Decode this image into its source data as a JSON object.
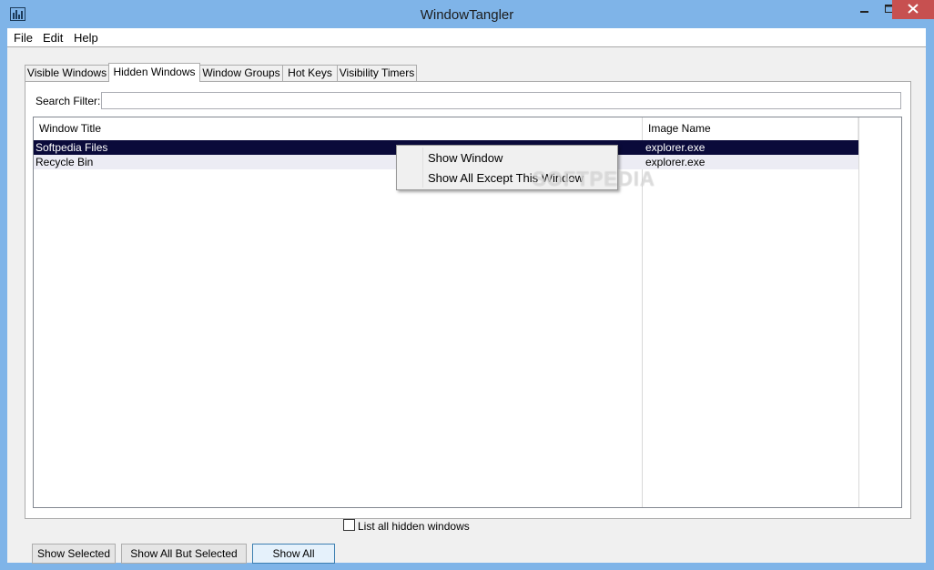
{
  "window": {
    "title": "WindowTangler",
    "colors": {
      "frame": "#7fb4e8",
      "close": "#c75050",
      "selection": "#0a0a3a"
    }
  },
  "icons": {
    "app": "chart-bars-icon",
    "minimize": "minimize-icon",
    "maximize": "maximize-icon",
    "close": "close-icon"
  },
  "menubar": {
    "items": [
      "File",
      "Edit",
      "Help"
    ]
  },
  "tabs": [
    {
      "label": "Visible Windows",
      "active": false
    },
    {
      "label": "Hidden Windows",
      "active": true
    },
    {
      "label": "Window Groups",
      "active": false
    },
    {
      "label": "Hot Keys",
      "active": false
    },
    {
      "label": "Visibility Timers",
      "active": false
    }
  ],
  "search": {
    "label": "Search Filter:",
    "value": ""
  },
  "list": {
    "columns": [
      "Window Title",
      "Image Name"
    ],
    "rows": [
      {
        "title": "Softpedia Files",
        "image": "explorer.exe",
        "selected": true
      },
      {
        "title": "Recycle Bin",
        "image": "explorer.exe",
        "selected": false
      }
    ]
  },
  "context_menu": {
    "items": [
      "Show Window",
      "Show All Except This Window"
    ]
  },
  "buttons": {
    "show_selected": "Show Selected",
    "show_all_but_selected": "Show All But Selected",
    "show_all": "Show All"
  },
  "checkbox": {
    "label": "List all hidden windows",
    "checked": false
  },
  "watermark": "SOFTPEDIA"
}
